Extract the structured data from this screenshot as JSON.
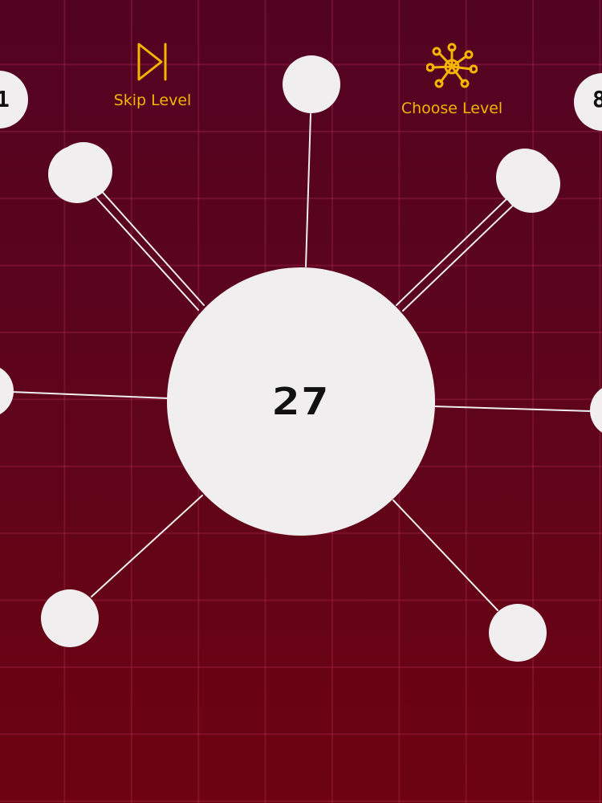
{
  "colors": {
    "background_top": "#520322",
    "background_bottom": "#6d0311",
    "grid_line": "#be325a",
    "pin": "#f0eeef",
    "hub": "#f0eeef",
    "counter_text": "#111111",
    "menu_accent": "#f5b400"
  },
  "hub": {
    "remaining_pins": "27"
  },
  "menu": {
    "skip_level": {
      "label": "Skip Level",
      "icon": "skip-forward-icon"
    },
    "choose_level": {
      "label": "Choose Level",
      "icon": "level-network-icon"
    }
  },
  "edge_labels": {
    "left": "1",
    "right": "8"
  },
  "board": {
    "pins_stuck_count": 8
  }
}
